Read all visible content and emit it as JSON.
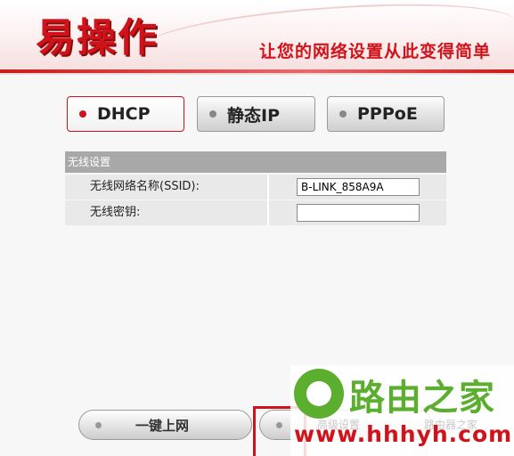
{
  "header": {
    "logo": "易操作",
    "slogan": "让您的网络设置从此变得简单"
  },
  "modes": [
    {
      "label": "DHCP",
      "selected": true
    },
    {
      "label": "静态IP",
      "selected": false
    },
    {
      "label": "PPPoE",
      "selected": false
    }
  ],
  "wireless": {
    "section_title": "无线设置",
    "ssid_label": "无线网络名称(SSID):",
    "ssid_value": "B-LINK_858A9A",
    "key_label": "无线密钥:",
    "key_value": ""
  },
  "buttons": {
    "one_click_label": "一键上网",
    "advanced_label": "高级设置",
    "router_home_label": "路由器之家"
  },
  "watermark": {
    "title": "路由之家",
    "url": "www.hhhyh.com"
  },
  "colors": {
    "brand_red": "#d0121b",
    "watermark_green": "#5cae2e"
  }
}
